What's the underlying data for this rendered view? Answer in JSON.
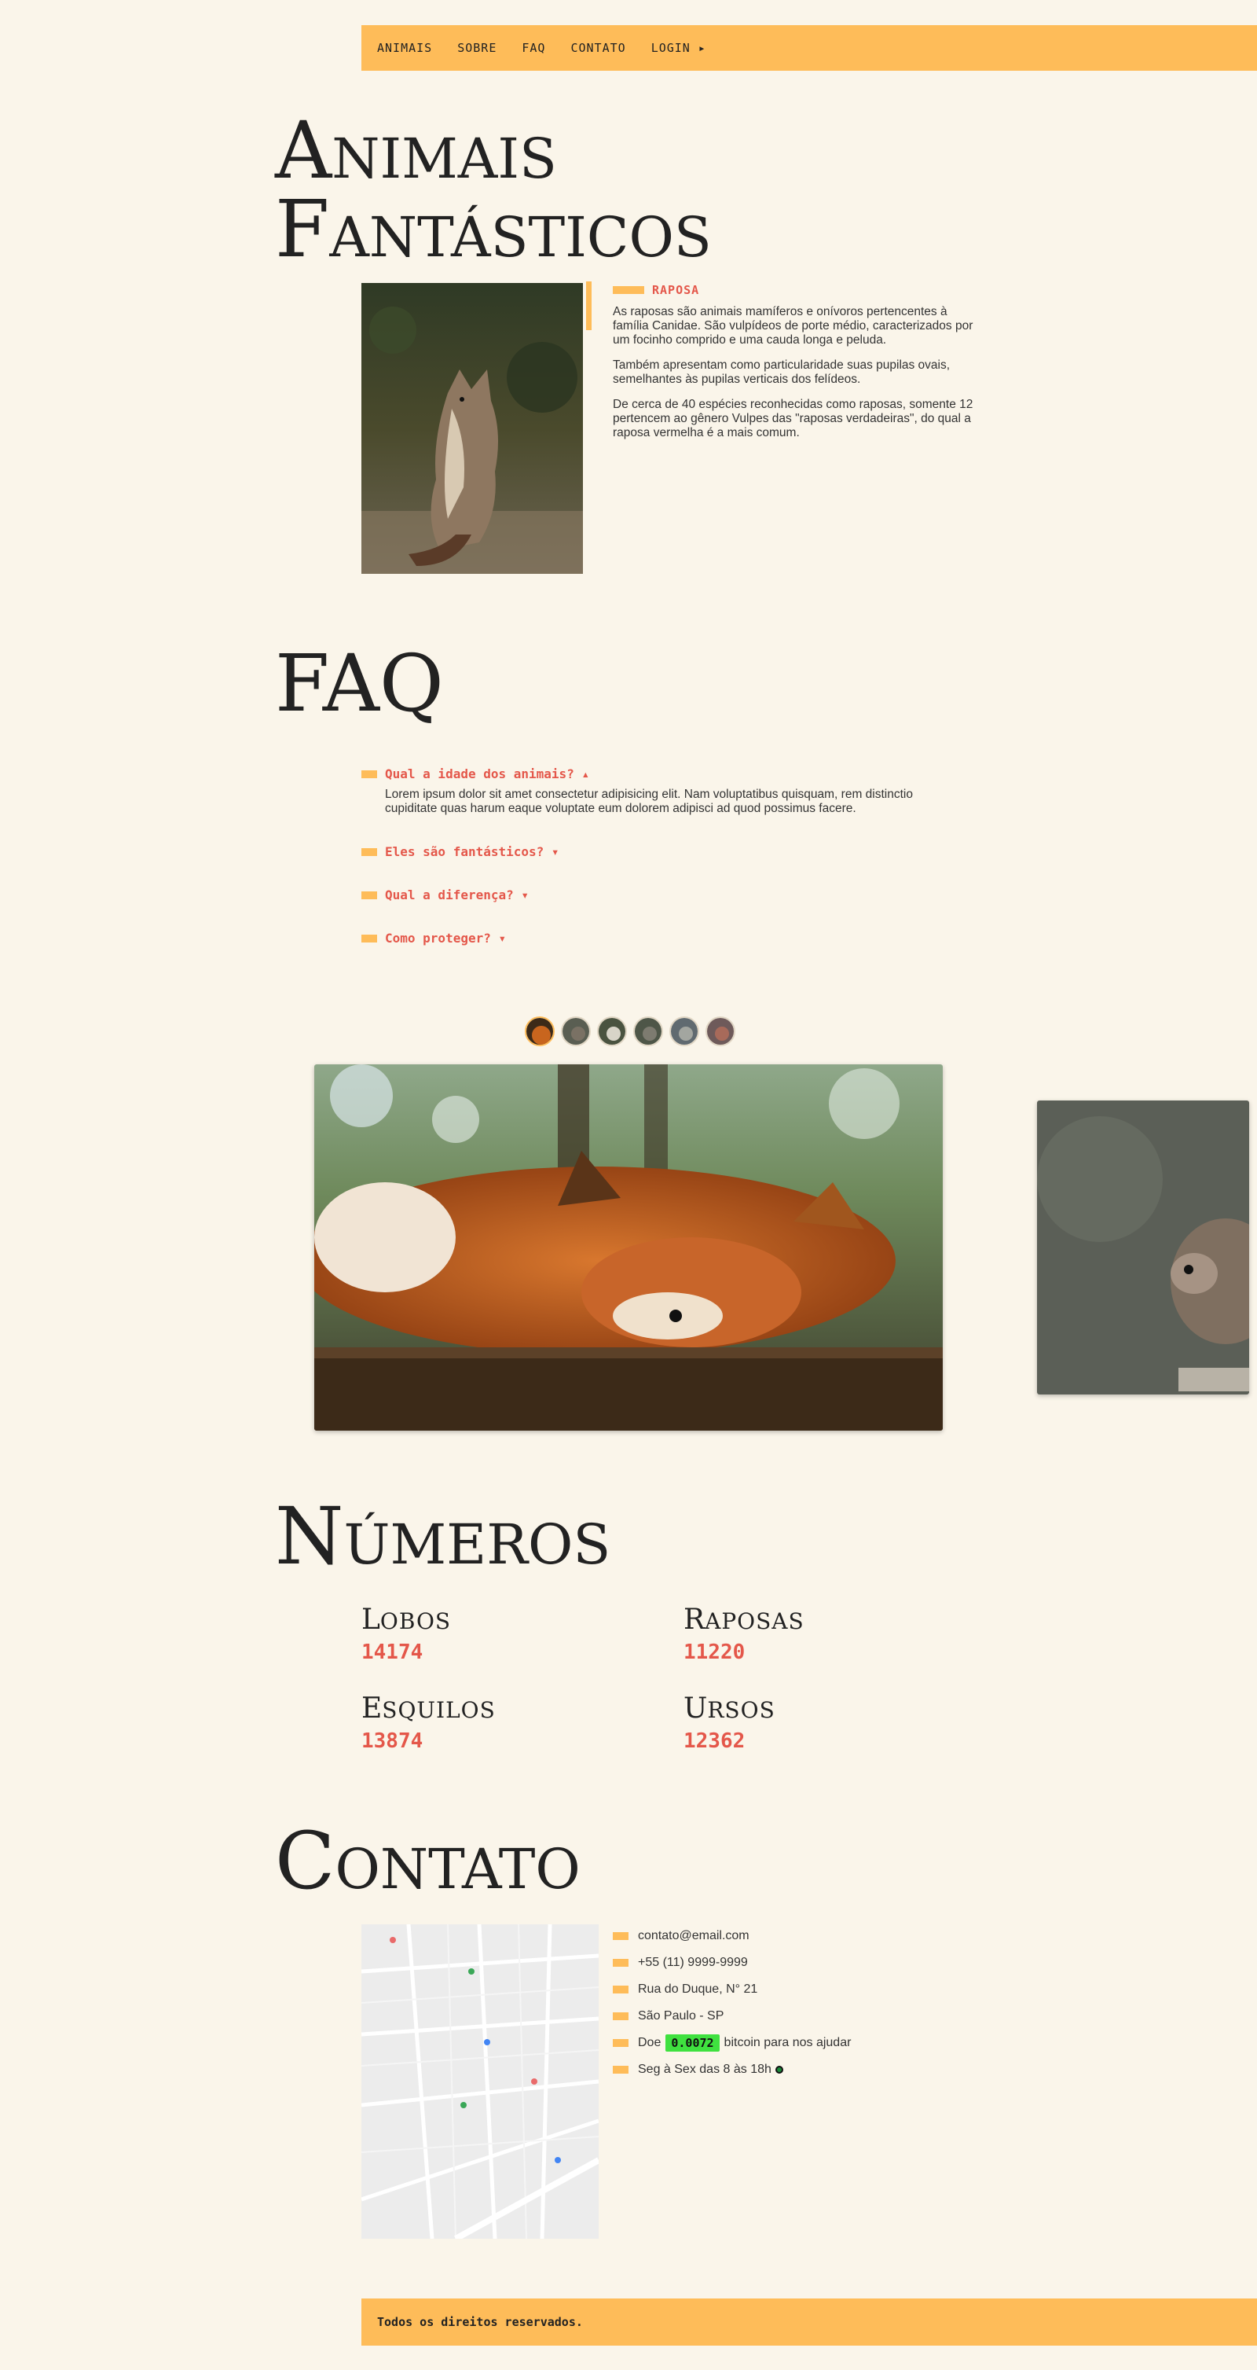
{
  "nav": {
    "items": [
      "ANIMAIS",
      "SOBRE",
      "FAQ",
      "CONTATO",
      "LOGIN ▸"
    ]
  },
  "animals_section": {
    "title_line1": "Animais",
    "title_line2": "Fantásticos",
    "animal_name": "RAPOSA",
    "paragraphs": [
      "As raposas são animais mamíferos e onívoros pertencentes à família Canidae. São vulpídeos de porte médio, caracterizados por um focinho comprido e uma cauda longa e peluda.",
      "Também apresentam como particularidade suas pupilas ovais, semelhantes às pupilas verticais dos felídeos.",
      "De cerca de 40 espécies reconhecidas como raposas, somente 12 pertencem ao gênero Vulpes das \"raposas verdadeiras\", do qual a raposa vermelha é a mais comum."
    ]
  },
  "faq_section": {
    "title": "FAQ",
    "items": [
      {
        "question": "Qual a idade dos animais? ▴",
        "answer": "Lorem ipsum dolor sit amet consectetur adipisicing elit. Nam voluptatibus quisquam, rem distinctio cupiditate quas harum eaque voluptate eum dolorem adipisci ad quod possimus facere."
      },
      {
        "question": "Eles são fantásticos? ▾"
      },
      {
        "question": "Qual a diferença? ▾"
      },
      {
        "question": "Como proteger? ▾"
      }
    ]
  },
  "numbers_section": {
    "title": "Números",
    "stats": [
      {
        "label_cap": "L",
        "label_rest": "OBOS",
        "value": "14174"
      },
      {
        "label_cap": "R",
        "label_rest": "APOSAS",
        "value": "11220"
      },
      {
        "label_cap": "E",
        "label_rest": "SQUILOS",
        "value": "13874"
      },
      {
        "label_cap": "U",
        "label_rest": "RSOS",
        "value": "12362"
      }
    ]
  },
  "contact_section": {
    "title": "Contato",
    "email": "contato@email.com",
    "phone": "+55 (11) 9999-9999",
    "address": "Rua do Duque, N° 21",
    "city": "São Paulo - SP",
    "donate_prefix": "Doe",
    "donate_amount": "0.0072",
    "donate_suffix": "bitcoin para nos ajudar",
    "hours": "Seg à Sex das 8 às 18h"
  },
  "footer": {
    "text": "Todos os direitos reservados."
  },
  "colors": {
    "accent_yellow": "#febc59",
    "accent_red": "#e4574a",
    "background": "#faf5ea",
    "bitcoin_green": "#3fe13f"
  },
  "icons": [
    "raposa-photo",
    "map-image",
    "online-status-icon"
  ]
}
